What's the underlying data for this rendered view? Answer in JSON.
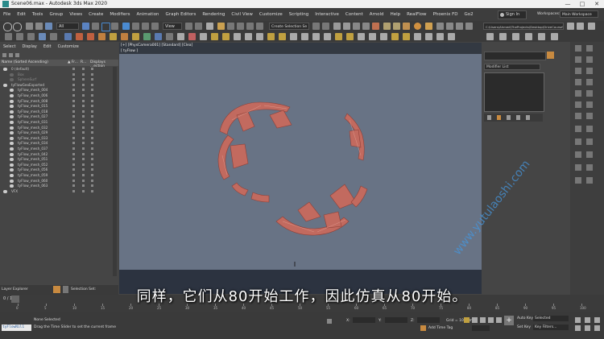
{
  "window": {
    "title": "Scene06.max - Autodesk 3ds Max 2020",
    "min": "—",
    "max": "□",
    "close": "✕"
  },
  "menu": [
    "File",
    "Edit",
    "Tools",
    "Group",
    "Views",
    "Create",
    "Modifiers",
    "Animation",
    "Graph Editors",
    "Rendering",
    "Civil View",
    "Customize",
    "Scripting",
    "Interactive",
    "Content",
    "Arnold",
    "Help",
    "RealFlow",
    "Phoenix FD",
    "Go2"
  ],
  "menu_right": {
    "signin": "Sign In",
    "workspaces": "Workspaces:",
    "workspace_value": "Main Workspace"
  },
  "toolbar": {
    "filter_value": "All",
    "view_value": "View",
    "selection_set": "Create Selection Se",
    "path": "C:\\Users\\Ahmed\\TheProjects\\Desktop\\DriveCourse\\3D\\Files\\DriveCours"
  },
  "scene_explorer": {
    "tabs": [
      "Select",
      "Display",
      "Edit",
      "Customize"
    ],
    "header": {
      "name": "Name (Sorted Ascending)",
      "fr": "▲ Fr...",
      "r": "R...",
      "display": "Displays ...ection"
    },
    "rows": [
      {
        "label": "0 (default)",
        "indent": 0
      },
      {
        "label": "Box",
        "indent": 1,
        "dim": true
      },
      {
        "label": "SphereSurf",
        "indent": 1,
        "dim": true
      },
      {
        "label": "tyFlowGeoExported",
        "indent": 0
      },
      {
        "label": "tyFlow_mesh_004",
        "indent": 1
      },
      {
        "label": "tyFlow_mesh_006",
        "indent": 1
      },
      {
        "label": "tyFlow_mesh_008",
        "indent": 1
      },
      {
        "label": "tyFlow_mesh_015",
        "indent": 1
      },
      {
        "label": "tyFlow_mesh_018",
        "indent": 1
      },
      {
        "label": "tyFlow_mesh_027",
        "indent": 1
      },
      {
        "label": "tyFlow_mesh_031",
        "indent": 1
      },
      {
        "label": "tyFlow_mesh_032",
        "indent": 1
      },
      {
        "label": "tyFlow_mesh_029",
        "indent": 1
      },
      {
        "label": "tyFlow_mesh_033",
        "indent": 1
      },
      {
        "label": "tyFlow_mesh_034",
        "indent": 1
      },
      {
        "label": "tyFlow_mesh_037",
        "indent": 1
      },
      {
        "label": "tyFlow_mesh_042",
        "indent": 1
      },
      {
        "label": "tyFlow_mesh_051",
        "indent": 1
      },
      {
        "label": "tyFlow_mesh_052",
        "indent": 1
      },
      {
        "label": "tyFlow_mesh_056",
        "indent": 1
      },
      {
        "label": "tyFlow_mesh_059",
        "indent": 1
      },
      {
        "label": "tyFlow_mesh_060",
        "indent": 1
      },
      {
        "label": "tyFlow_mesh_063",
        "indent": 1
      },
      {
        "label": "VFX",
        "indent": 0
      }
    ],
    "footer": {
      "layer": "Layer Explorer",
      "sel": "Selection Set:"
    }
  },
  "viewport": {
    "label": "[+] [PhysCamera001] [Standard] [Clea]",
    "sub_label": "[ tyFlow ]"
  },
  "modify_panel": {
    "modifier_list": "Modifier List"
  },
  "timeline": {
    "frame_readout": "0 / 100",
    "ticks": [
      "0",
      "5",
      "10",
      "15",
      "20",
      "25",
      "30",
      "35",
      "40",
      "45",
      "50",
      "55",
      "60",
      "65",
      "70",
      "75",
      "80",
      "85",
      "90",
      "95",
      "100"
    ]
  },
  "status": {
    "script": "tyFlowNil1",
    "none_selected": "None Selected",
    "hint": "Drag the Time Slider to set the current frame",
    "x": "X:",
    "y": "Y:",
    "z": "Z:",
    "grid": "Grid = 10.0cm",
    "add_time_tag": "Add Time Tag",
    "auto_key": "Auto Key",
    "selected": "Selected",
    "set_key": "Set Key",
    "key_filters": "Key Filters..."
  },
  "subtitle": "同样，它们从80开始工作，因此仿真从80开始。",
  "watermark": "www.yutulaoshi.com",
  "colors": {
    "particles": "#c2685e",
    "viewport_bg": "#687385"
  }
}
